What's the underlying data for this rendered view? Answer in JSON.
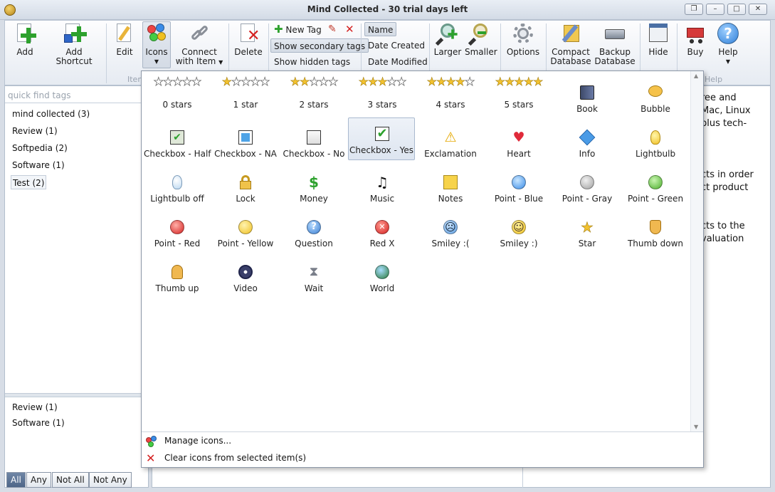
{
  "window": {
    "title": "Mind Collected - 30 trial days left"
  },
  "ribbon": {
    "add": "Add",
    "add_shortcut": "Add Shortcut",
    "edit": "Edit",
    "icons": "Icons",
    "connect_line1": "Connect",
    "connect_line2": "with Item",
    "delete": "Delete",
    "new_tag": "New Tag",
    "show_secondary_tags": "Show secondary tags",
    "show_hidden_tags": "Show hidden tags",
    "sort_name": "Name",
    "sort_created": "Date Created",
    "sort_modified": "Date Modified",
    "larger": "Larger",
    "smaller": "Smaller",
    "options": "Options",
    "compact_line1": "Compact",
    "compact_line2": "Database",
    "backup_line1": "Backup",
    "backup_line2": "Database",
    "hide": "Hide",
    "buy": "Buy",
    "help": "Help",
    "group_item": "Item",
    "group_help": "Help"
  },
  "sidebar": {
    "quickfind_placeholder": "quick find tags",
    "tags": [
      "mind collected (3)",
      "Review (1)",
      "Softpedia (2)",
      "Software (1)",
      "Test (2)"
    ],
    "secondary": [
      "Review (1)",
      "Software (1)"
    ],
    "filters": [
      "All",
      "Any",
      "Not All",
      "Not Any"
    ]
  },
  "main": {
    "text_lines": [
      "ree and",
      "Mac, Linux",
      "plus tech-",
      "cts in order",
      "ct product",
      "cts to the",
      "valuation"
    ]
  },
  "icons_menu": {
    "ratings": [
      "0 stars",
      "1 star",
      "2 stars",
      "3 stars",
      "4 stars",
      "5 stars"
    ],
    "book": "Book",
    "bubble": "Bubble",
    "row2": [
      "Checkbox - Half",
      "Checkbox - NA",
      "Checkbox - No",
      "Checkbox - Yes",
      "Exclamation",
      "Heart",
      "Info",
      "Lightbulb"
    ],
    "row3": [
      "Lightbulb off",
      "Lock",
      "Money",
      "Music",
      "Notes",
      "Point - Blue",
      "Point - Gray",
      "Point - Green"
    ],
    "row4": [
      "Point - Red",
      "Point - Yellow",
      "Question",
      "Red X",
      "Smiley :(",
      "Smiley :)",
      "Star",
      "Thumb down"
    ],
    "row5": [
      "Thumb up",
      "Video",
      "Wait",
      "World"
    ],
    "manage": "Manage icons...",
    "clear": "Clear icons from selected item(s)"
  },
  "colors": {
    "accent": "#4e6688",
    "selection": "#dde5f0",
    "green": "#2da12d",
    "red": "#d42020"
  }
}
